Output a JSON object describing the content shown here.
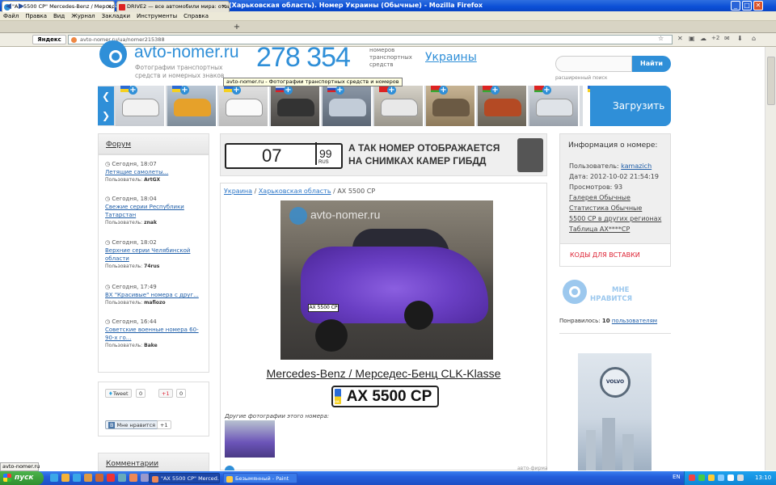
{
  "window": {
    "title": "\"AX 5500 CP\" Mercedes-Benz / Мерседес-Бенц CLK-Klasse (Харьковская область). Номер Украины (Обычные) - Mozilla Firefox",
    "min": "_",
    "max": "□",
    "close": "✕"
  },
  "menu": [
    "Файл",
    "Правка",
    "Вид",
    "Журнал",
    "Закладки",
    "Инструменты",
    "Справка"
  ],
  "tabs": [
    {
      "label": "\"AX 5500 CP\" Mercedes-Benz / Мерседе...",
      "close": "×"
    },
    {
      "label": "DRIVE2 — все автомобили мира: отзыв...",
      "close": "×"
    }
  ],
  "newtab": "+",
  "nav": {
    "back": "◀",
    "forward": "▶",
    "yandex": "Яндекс",
    "url": "avto-nomer.ru/ua/nomer215388",
    "plus2": "+2"
  },
  "site": {
    "logo": "avto-nomer.ru",
    "logo_sub": "Фотографии транспортных средств и номерных знаков",
    "counter": "278 354",
    "counter_label": "номеров транспортных средств",
    "country": "Украины",
    "search_button": "Найти",
    "search_placeholder": "",
    "advanced_search": "расширенный поиск",
    "tooltip": "avto-nomer.ru - Фотографии транспортных средств и номеров",
    "upload": "Загрузить"
  },
  "forum": {
    "title": "Форум",
    "items": [
      {
        "time": "Сегодня, 18:07",
        "title": "Летящие самолеты...",
        "user_label": "Пользователь:",
        "user": "ArtGX"
      },
      {
        "time": "Сегодня, 18:04",
        "title": "Свежие серии Республики Татарстан",
        "user_label": "Пользователь:",
        "user": "znak"
      },
      {
        "time": "Сегодня, 18:02",
        "title": "Верхние серии Челябинской области",
        "user_label": "Пользователь:",
        "user": "74rus"
      },
      {
        "time": "Сегодня, 17:49",
        "title": "ВХ \"Красивые\" номера с друг...",
        "user_label": "Пользователь:",
        "user": "mafiozo"
      },
      {
        "time": "Сегодня, 16:44",
        "title": "Советские военные номера 60-90-х го...",
        "user_label": "Пользователь:",
        "user": "Bake"
      }
    ]
  },
  "social": {
    "tweet": "Tweet",
    "tweet_count": "0",
    "gplus": "+1",
    "gplus_count": "0",
    "vk": "Мне нравится",
    "vk_count": "+1"
  },
  "comments_title": "Комментарии",
  "banner": {
    "plate_num": "07",
    "plate_region": "99",
    "plate_rus": "RUS",
    "text": "А ТАК НОМЕР ОТОБРАЖАЕТСЯ НА СНИМКАХ КАМЕР ГИБДД"
  },
  "crumbs": {
    "country": "Украина",
    "sep": " / ",
    "region": "Харьковская область",
    "plate": "AX 5500 CP"
  },
  "photo": {
    "watermark": "avto-nomer.ru",
    "plate_small": "AX 5500 CP"
  },
  "car": {
    "make": "Mercedes-Benz / Мерседес-Бенц",
    "model": "CLK-Klasse",
    "plate": "AX 5500 CP",
    "plate_flag": "UA"
  },
  "other_photos_label": "Другие фотографии этого номера:",
  "footer_small": "авто-фирма",
  "info": {
    "title": "Информация о номере:",
    "user_label": "Пользователь:",
    "user": "kamazich",
    "date": "Дата: 2012-10-02 21:54:19",
    "views": "Просмотров: 93",
    "links": [
      "Галерея Обычные",
      "Статистика Обычные",
      "5500 CP в других регионах",
      "Таблица AX****CP"
    ],
    "codes": "КОДЫ ДЛЯ ВСТАВКИ"
  },
  "like": {
    "line1": "МНЕ",
    "line2": "НРАВИТСЯ",
    "liked_label": "Понравилось:",
    "liked_count": "10",
    "liked_users": "пользователям"
  },
  "ad": {
    "brand": "VOLVO"
  },
  "statusbar": "avto-nomer.ru",
  "taskbar": {
    "start": "пуск",
    "task1": "\"AX 5500 CP\" Merced...",
    "task2": "Безымянный - Paint",
    "lang": "EN",
    "clock": "13:10"
  }
}
